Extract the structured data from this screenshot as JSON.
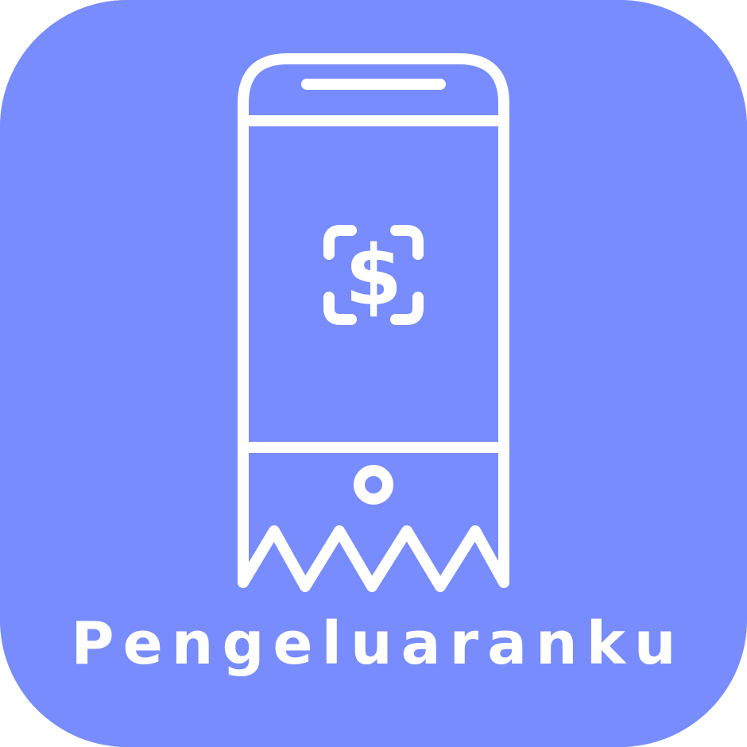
{
  "app": {
    "name": "Pengeluaranku",
    "icon": "phone-receipt-dollar-icon",
    "colors": {
      "background": "#788cfd",
      "foreground": "#ffffff"
    }
  }
}
